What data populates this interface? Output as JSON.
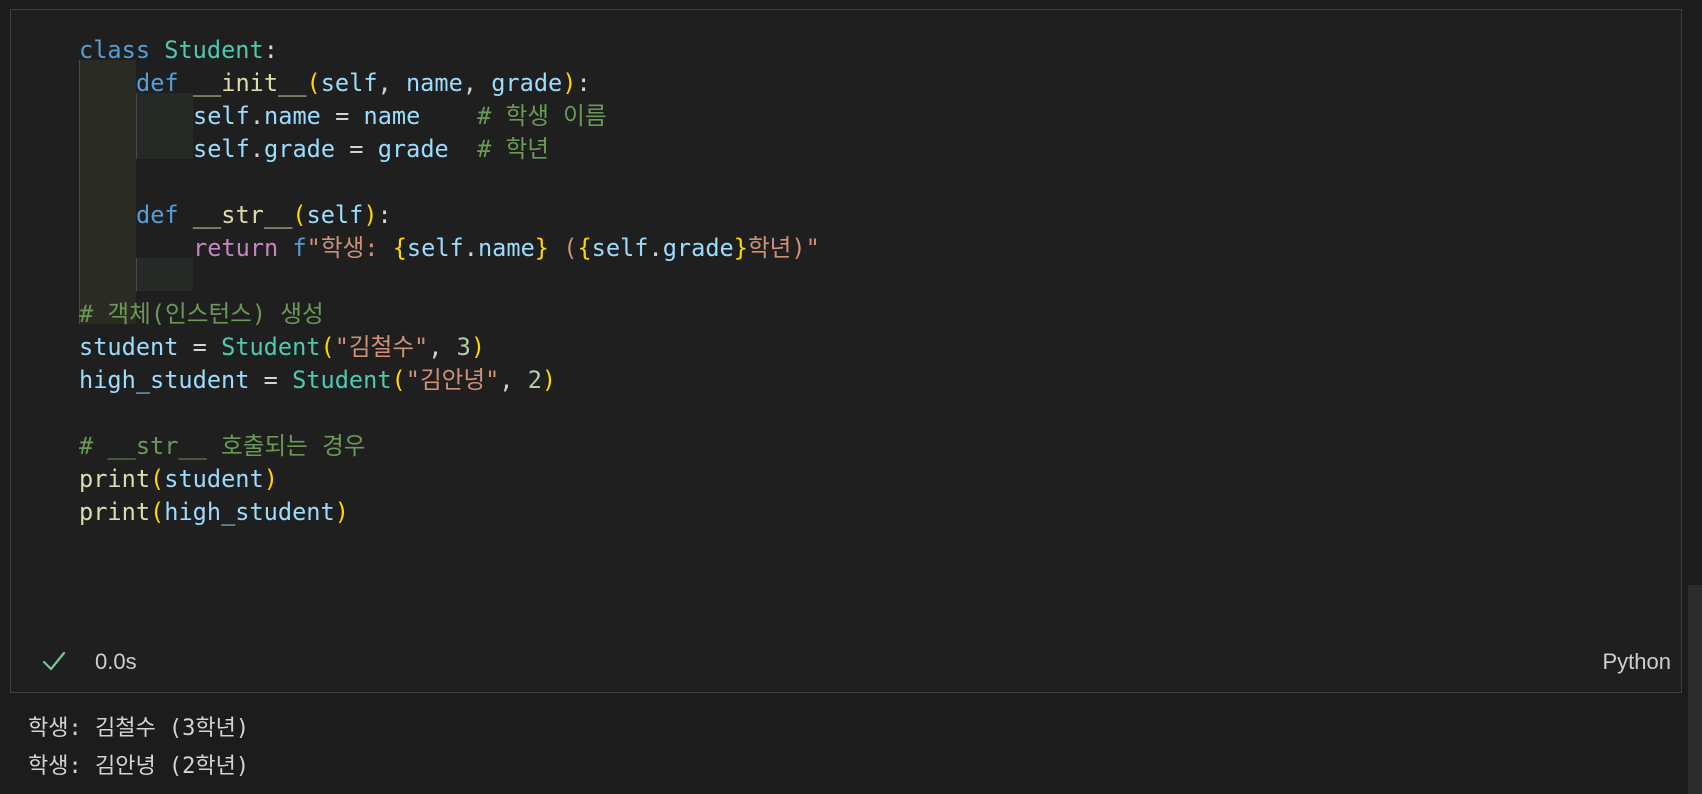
{
  "code_lines": [
    {
      "indent": 0,
      "tokens": [
        {
          "t": "class",
          "c": "kw"
        },
        {
          "t": " ",
          "c": "op"
        },
        {
          "t": "Student",
          "c": "cls"
        },
        {
          "t": ":",
          "c": "op"
        }
      ]
    },
    {
      "indent": 1,
      "tokens": [
        {
          "t": "def",
          "c": "kw"
        },
        {
          "t": " ",
          "c": "op"
        },
        {
          "t": "__init__",
          "c": "fn"
        },
        {
          "t": "(",
          "c": "br1"
        },
        {
          "t": "self",
          "c": "var"
        },
        {
          "t": ", ",
          "c": "op"
        },
        {
          "t": "name",
          "c": "var"
        },
        {
          "t": ", ",
          "c": "op"
        },
        {
          "t": "grade",
          "c": "var"
        },
        {
          "t": ")",
          "c": "br1"
        },
        {
          "t": ":",
          "c": "op"
        }
      ]
    },
    {
      "indent": 2,
      "tokens": [
        {
          "t": "self",
          "c": "var"
        },
        {
          "t": ".",
          "c": "op"
        },
        {
          "t": "name",
          "c": "var"
        },
        {
          "t": " = ",
          "c": "op"
        },
        {
          "t": "name",
          "c": "var"
        },
        {
          "t": "    ",
          "c": "op"
        },
        {
          "t": "# 학생 이름",
          "c": "cmt"
        }
      ]
    },
    {
      "indent": 2,
      "tokens": [
        {
          "t": "self",
          "c": "var"
        },
        {
          "t": ".",
          "c": "op"
        },
        {
          "t": "grade",
          "c": "var"
        },
        {
          "t": " = ",
          "c": "op"
        },
        {
          "t": "grade",
          "c": "var"
        },
        {
          "t": "  ",
          "c": "op"
        },
        {
          "t": "# 학년",
          "c": "cmt"
        }
      ]
    },
    {
      "indent": 0,
      "tokens": []
    },
    {
      "indent": 1,
      "tokens": [
        {
          "t": "def",
          "c": "kw"
        },
        {
          "t": " ",
          "c": "op"
        },
        {
          "t": "__str__",
          "c": "fn"
        },
        {
          "t": "(",
          "c": "br1"
        },
        {
          "t": "self",
          "c": "var"
        },
        {
          "t": ")",
          "c": "br1"
        },
        {
          "t": ":",
          "c": "op"
        }
      ]
    },
    {
      "indent": 2,
      "tokens": [
        {
          "t": "return",
          "c": "ctl"
        },
        {
          "t": " ",
          "c": "op"
        },
        {
          "t": "f",
          "c": "kw"
        },
        {
          "t": "\"학생: ",
          "c": "str"
        },
        {
          "t": "{",
          "c": "br1"
        },
        {
          "t": "self",
          "c": "var"
        },
        {
          "t": ".",
          "c": "op"
        },
        {
          "t": "name",
          "c": "var"
        },
        {
          "t": "}",
          "c": "br1"
        },
        {
          "t": " (",
          "c": "str"
        },
        {
          "t": "{",
          "c": "br1"
        },
        {
          "t": "self",
          "c": "var"
        },
        {
          "t": ".",
          "c": "op"
        },
        {
          "t": "grade",
          "c": "var"
        },
        {
          "t": "}",
          "c": "br1"
        },
        {
          "t": "학년)\"",
          "c": "str"
        }
      ]
    },
    {
      "indent": 0,
      "tokens": []
    },
    {
      "indent": 0,
      "tokens": [
        {
          "t": "# 객체(인스턴스) 생성",
          "c": "cmt"
        }
      ]
    },
    {
      "indent": 0,
      "tokens": [
        {
          "t": "student",
          "c": "var"
        },
        {
          "t": " = ",
          "c": "op"
        },
        {
          "t": "Student",
          "c": "cls"
        },
        {
          "t": "(",
          "c": "br1"
        },
        {
          "t": "\"김철수\"",
          "c": "str"
        },
        {
          "t": ", ",
          "c": "op"
        },
        {
          "t": "3",
          "c": "num"
        },
        {
          "t": ")",
          "c": "br1"
        }
      ]
    },
    {
      "indent": 0,
      "tokens": [
        {
          "t": "high_student",
          "c": "var"
        },
        {
          "t": " = ",
          "c": "op"
        },
        {
          "t": "Student",
          "c": "cls"
        },
        {
          "t": "(",
          "c": "br1"
        },
        {
          "t": "\"김안녕\"",
          "c": "str"
        },
        {
          "t": ", ",
          "c": "op"
        },
        {
          "t": "2",
          "c": "num"
        },
        {
          "t": ")",
          "c": "br1"
        }
      ]
    },
    {
      "indent": 0,
      "tokens": []
    },
    {
      "indent": 0,
      "tokens": [
        {
          "t": "# __str__ 호출되는 경우",
          "c": "cmt"
        }
      ]
    },
    {
      "indent": 0,
      "tokens": [
        {
          "t": "print",
          "c": "fn"
        },
        {
          "t": "(",
          "c": "br1"
        },
        {
          "t": "student",
          "c": "var"
        },
        {
          "t": ")",
          "c": "br1"
        }
      ]
    },
    {
      "indent": 0,
      "tokens": [
        {
          "t": "print",
          "c": "fn"
        },
        {
          "t": "(",
          "c": "br1"
        },
        {
          "t": "high_student",
          "c": "var"
        },
        {
          "t": ")",
          "c": "br1"
        }
      ]
    }
  ],
  "status": {
    "icon": "check-icon",
    "success_color": "#73c991",
    "exec_time": "0.0s",
    "language": "Python"
  },
  "output_lines": [
    "학생: 김철수 (3학년)",
    "학생: 김안녕 (2학년)"
  ]
}
